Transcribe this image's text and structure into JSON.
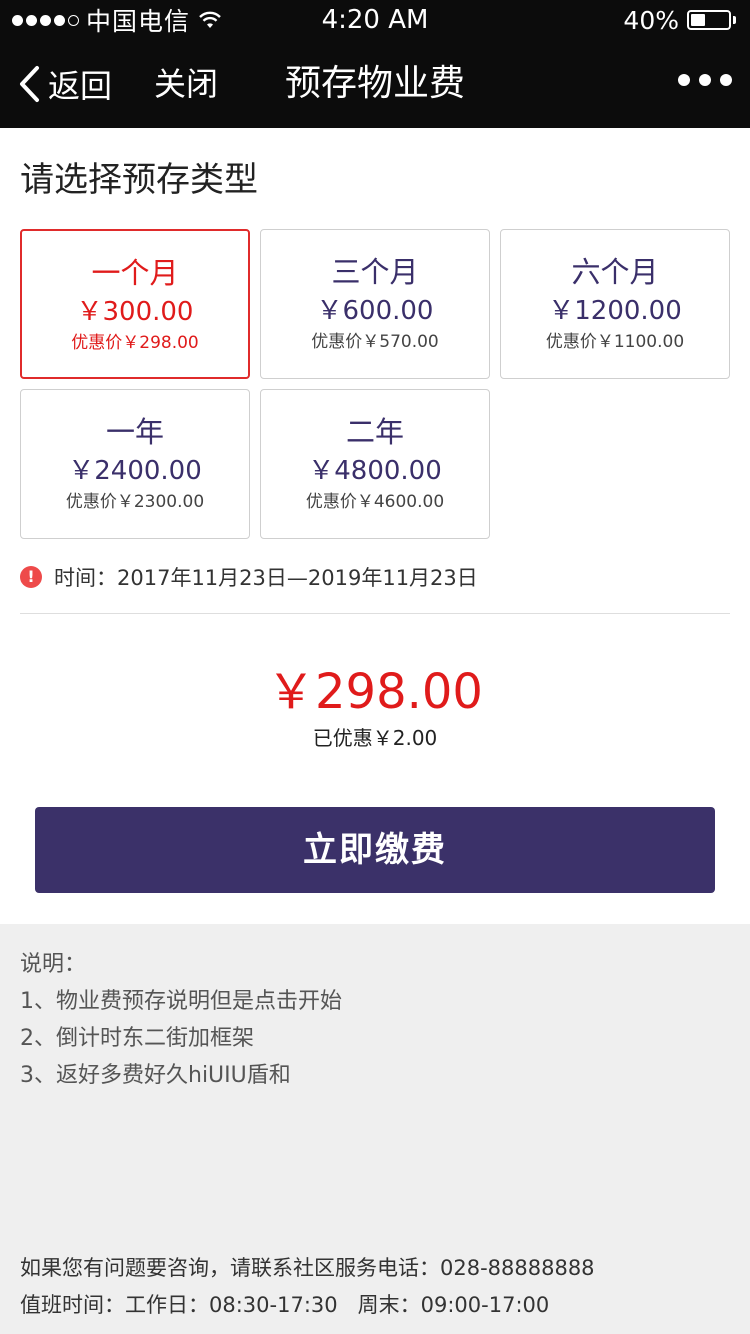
{
  "status_bar": {
    "carrier": "中国电信",
    "time": "4:20 AM",
    "battery": "40%",
    "battery_level": 0.4
  },
  "nav": {
    "back_label": "返回",
    "close_label": "关闭",
    "title": "预存物业费",
    "more_icon": "ellipsis-icon"
  },
  "section_title": "请选择预存类型",
  "options": [
    {
      "name": "一个月",
      "price": "￥300.00",
      "discount": "优惠价￥298.00",
      "selected": true
    },
    {
      "name": "三个月",
      "price": "￥600.00",
      "discount": "优惠价￥570.00",
      "selected": false
    },
    {
      "name": "六个月",
      "price": "￥1200.00",
      "discount": "优惠价￥1100.00",
      "selected": false
    },
    {
      "name": "一年",
      "price": "￥2400.00",
      "discount": "优惠价￥2300.00",
      "selected": false
    },
    {
      "name": "二年",
      "price": "￥4800.00",
      "discount": "优惠价￥4600.00",
      "selected": false
    }
  ],
  "time_notice": "时间：2017年11月23日—2019年11月23日",
  "total": "￥298.00",
  "saved": "已优惠￥2.00",
  "pay_button": "立即缴费",
  "notes": {
    "heading": "说明：",
    "items": [
      "1、物业费预存说明但是点击开始",
      "2、倒计时东二街加框架",
      "3、返好多费好久hiUIU盾和"
    ]
  },
  "contact": {
    "phone_line": "如果您有问题要咨询，请联系社区服务电话：028-88888888",
    "hours_line": "值班时间：工作日：08:30-17:30   周末：09:00-17:00"
  },
  "colors": {
    "accent_red": "#e01b1b",
    "brand_purple": "#3b3169",
    "nav_bg": "#0c0c0c",
    "page_gray": "#efefef"
  }
}
